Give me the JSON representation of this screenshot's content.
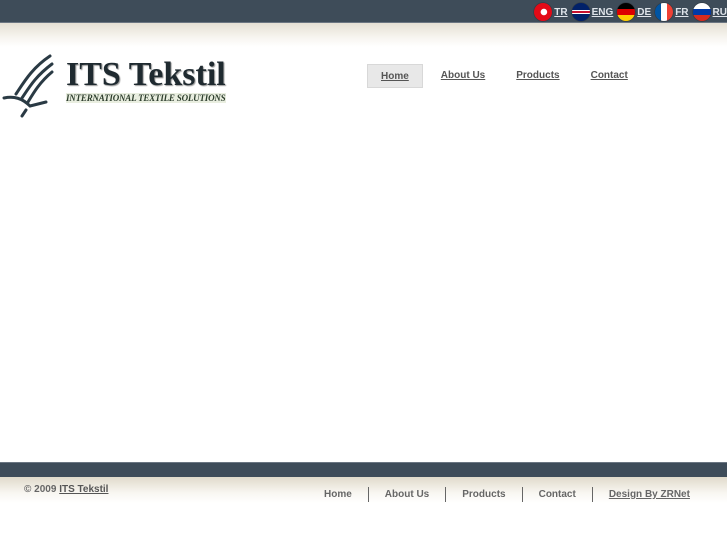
{
  "languages": [
    {
      "code": "TR",
      "flag": "turkey-flag-icon",
      "colors": [
        "#e30a17",
        "#ffffff"
      ]
    },
    {
      "code": "ENG",
      "flag": "uk-flag-icon",
      "colors": [
        "#012169",
        "#c8102e"
      ]
    },
    {
      "code": "DE",
      "flag": "germany-flag-icon",
      "colors": [
        "#000000",
        "#dd0000",
        "#ffce00"
      ]
    },
    {
      "code": "FR",
      "flag": "france-flag-icon",
      "colors": [
        "#0055a4",
        "#ffffff",
        "#ef4135"
      ]
    },
    {
      "code": "RU",
      "flag": "russia-flag-icon",
      "colors": [
        "#ffffff",
        "#0039a6",
        "#d52b1e"
      ]
    }
  ],
  "logo": {
    "title": "ITS Tekstil",
    "subtitle": "INTERNATIONAL TEXTILE SOLUTIONS"
  },
  "nav": [
    "Home",
    "About Us",
    "Products",
    "Contact"
  ],
  "footer": {
    "copyright": "© 2009",
    "company": "ITS Tekstil",
    "links": [
      "Home",
      "About Us",
      "Products",
      "Contact"
    ],
    "credit": "Design By ZRNet"
  }
}
